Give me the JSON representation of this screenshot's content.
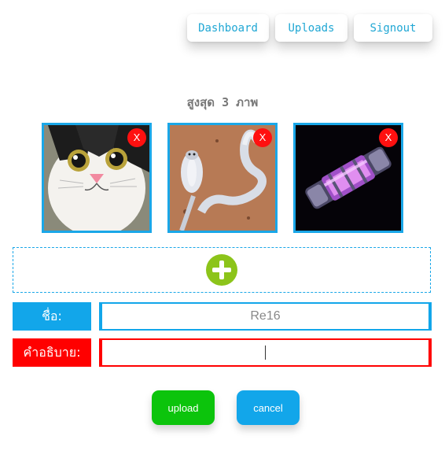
{
  "nav": {
    "dashboard": "Dashboard",
    "uploads": "Uploads",
    "signout": "Signout"
  },
  "uploader": {
    "max_label": "สูงสุด 3 ภาพ",
    "thumbnails": [
      {
        "subject": "cat",
        "remove_label": "X"
      },
      {
        "subject": "cobra",
        "remove_label": "X"
      },
      {
        "subject": "glowing-capsule",
        "remove_label": "X"
      }
    ],
    "add_icon": "plus-circle-icon"
  },
  "form": {
    "name_label": "ชื่อ:",
    "name_value": "Re16",
    "description_label": "คำอธิบาย:",
    "description_value": ""
  },
  "actions": {
    "upload": "upload",
    "cancel": "cancel"
  },
  "colors": {
    "accent_blue": "#12a6ea",
    "error_red": "#ff0000",
    "upload_green": "#0cc40c",
    "add_icon_green": "#8cc41a"
  }
}
